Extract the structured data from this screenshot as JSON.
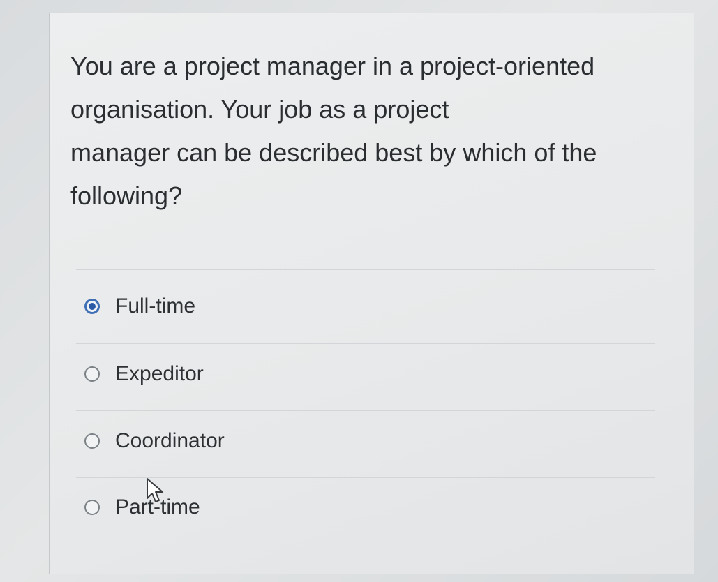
{
  "question": {
    "lines": [
      "You are a project manager in a project-oriented",
      "organisation. Your job as a project",
      "manager can be described best by which of the",
      "following?"
    ]
  },
  "options": [
    {
      "label": "Full-time",
      "selected": true
    },
    {
      "label": "Expeditor",
      "selected": false
    },
    {
      "label": "Coordinator",
      "selected": false
    },
    {
      "label": "Part-time",
      "selected": false
    }
  ],
  "colors": {
    "accent": "#2a5aa6",
    "text": "#2b2e31"
  },
  "icons": {
    "cursor": "arrow-pointer-icon"
  }
}
